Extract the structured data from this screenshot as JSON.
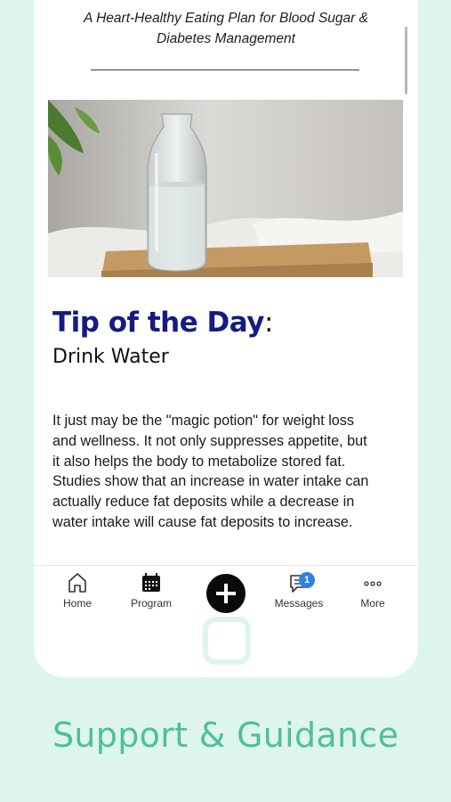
{
  "article": {
    "title": "A Heart-Healthy Eating Plan for Blood Sugar & Diabetes Management"
  },
  "tip": {
    "heading": "Tip of the Day",
    "heading_suffix": ":",
    "subtitle": "Drink Water",
    "body": "It just may be the \"magic potion\" for weight loss\nand wellness.  It not only suppresses appetite, but\nit also helps the body to metabolize stored fat.\n Studies show that an increase in water intake can\nactually reduce fat deposits while a decrease in\nwater intake will cause fat deposits to increase."
  },
  "tabbar": {
    "home": "Home",
    "program": "Program",
    "messages": "Messages",
    "messages_badge": "1",
    "more": "More"
  },
  "caption": "Support & Guidance",
  "colors": {
    "background": "#def5ec",
    "heading": "#151b83",
    "caption": "#4ec09a",
    "badge": "#2f7fe6"
  }
}
